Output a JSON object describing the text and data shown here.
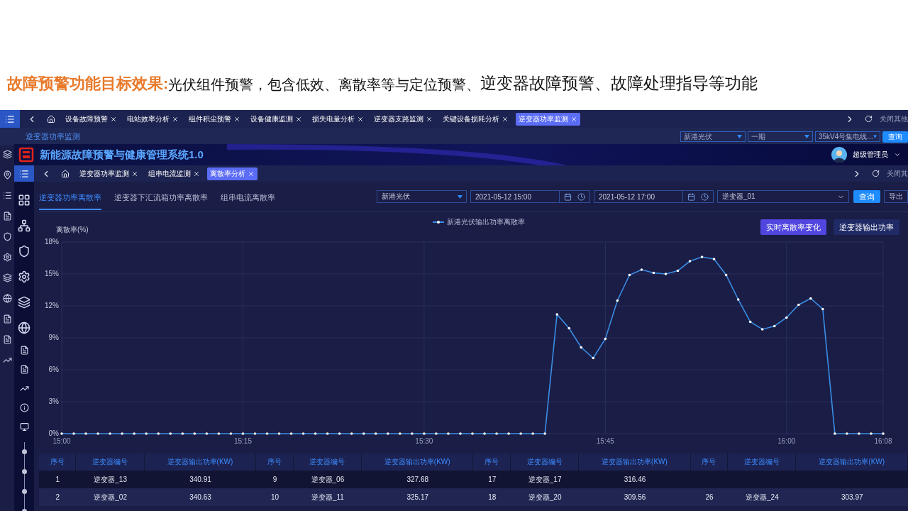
{
  "heading": {
    "label": "故障预警功能目标效果:",
    "lead": "光伏组件预警，包含低效、离散率等与定位预警、",
    "text": "逆变器故障预警、故障处理指导等功能"
  },
  "back_window": {
    "tabs": [
      {
        "label": "设备故障预警",
        "selected": false
      },
      {
        "label": "电站效率分析",
        "selected": false
      },
      {
        "label": "组件积尘预警",
        "selected": false
      },
      {
        "label": "设备健康监测",
        "selected": false
      },
      {
        "label": "损失电量分析",
        "selected": false
      },
      {
        "label": "逆变器支路监测",
        "selected": false
      },
      {
        "label": "关键设备损耗分析",
        "selected": false
      },
      {
        "label": "逆变器功率监测",
        "selected": true
      }
    ],
    "close_others": "关闭其他",
    "page_title": "逆变器功率监测",
    "filters": [
      "新港光伏",
      "一期",
      "35kV4号集电线..."
    ],
    "query_button": "查询"
  },
  "front_window": {
    "app_title": "新能源故障预警与健康管理系统1.0",
    "user": "超级管理员",
    "tabs": [
      {
        "label": "逆变器功率监测",
        "selected": false
      },
      {
        "label": "组串电流监测",
        "selected": false
      },
      {
        "label": "离散率分析",
        "selected": true
      }
    ],
    "close_others": "关闭其",
    "subtabs": [
      {
        "label": "逆变器功率离散率",
        "selected": true
      },
      {
        "label": "逆变器下汇流箱功率离散率",
        "selected": false
      },
      {
        "label": "组串电流离散率",
        "selected": false
      }
    ],
    "filters": {
      "station": "新港光伏",
      "start": "2021-05-12 15:00",
      "end": "2021-05-12 17:00",
      "inverter": "逆变器_01"
    },
    "query_button": "查询",
    "export_button": "导出",
    "chart_buttons": [
      {
        "label": "实时离散率变化",
        "selected": true
      },
      {
        "label": "逆变器输出功率",
        "selected": false
      }
    ],
    "chart_data": {
      "type": "line",
      "ylabel": "离散率(%)",
      "categories": [
        "15:00",
        null,
        null,
        null,
        null,
        null,
        null,
        null,
        null,
        null,
        null,
        null,
        null,
        null,
        null,
        "15:15",
        null,
        null,
        null,
        null,
        null,
        null,
        null,
        null,
        null,
        null,
        null,
        null,
        null,
        null,
        "15:30",
        null,
        null,
        null,
        null,
        null,
        null,
        null,
        null,
        null,
        null,
        null,
        null,
        null,
        null,
        "15:45",
        null,
        null,
        null,
        null,
        null,
        null,
        null,
        null,
        null,
        null,
        null,
        null,
        null,
        null,
        "16:00",
        null,
        null,
        null,
        null,
        null,
        null,
        null,
        "16:08"
      ],
      "series": [
        {
          "name": "新港光伏输出功率离散率",
          "color": "#3a8ee6",
          "values": [
            0,
            0,
            0,
            0,
            0,
            0,
            0,
            0,
            0,
            0,
            0,
            0,
            0,
            0,
            0,
            0,
            0,
            0,
            0,
            0,
            0,
            0,
            0,
            0,
            0,
            0,
            0,
            0,
            0,
            0,
            0,
            0,
            0,
            0,
            0,
            0,
            0,
            0,
            0,
            0,
            0,
            11.2,
            9.9,
            8.1,
            7.1,
            8.9,
            12.5,
            14.9,
            15.4,
            15.1,
            15.0,
            15.3,
            16.2,
            16.6,
            16.4,
            14.9,
            12.6,
            10.5,
            9.8,
            10.1,
            10.9,
            12.1,
            12.7,
            11.7,
            0,
            0,
            0,
            0,
            0
          ]
        }
      ],
      "ylim": [
        0,
        18
      ],
      "grid": true,
      "yticks": [
        {
          "value": 0,
          "label": "0%"
        },
        {
          "value": 3,
          "label": "3%"
        },
        {
          "value": 6,
          "label": "6%"
        },
        {
          "value": 9,
          "label": "9%"
        },
        {
          "value": 12,
          "label": "12%"
        },
        {
          "value": 15,
          "label": "15%"
        },
        {
          "value": 18,
          "label": "18%"
        }
      ]
    },
    "table": {
      "columns": [
        "序号",
        "逆变器编号",
        "逆变器输出功率(KW)",
        "序号",
        "逆变器编号",
        "逆变器输出功率(KW)",
        "序号",
        "逆变器编号",
        "逆变器输出功率(KW)",
        "序号",
        "逆变器编号",
        "逆变器输出功率(KW)"
      ],
      "rows": [
        [
          "1",
          "逆变器_13",
          "340.91",
          "9",
          "逆变器_06",
          "327.68",
          "17",
          "逆变器_17",
          "316.46",
          null,
          null,
          null
        ],
        [
          "2",
          "逆变器_02",
          "340.63",
          "10",
          "逆变器_11",
          "325.17",
          "18",
          "逆变器_20",
          "309.56",
          "26",
          "逆变器_24",
          "303.97"
        ]
      ]
    }
  }
}
